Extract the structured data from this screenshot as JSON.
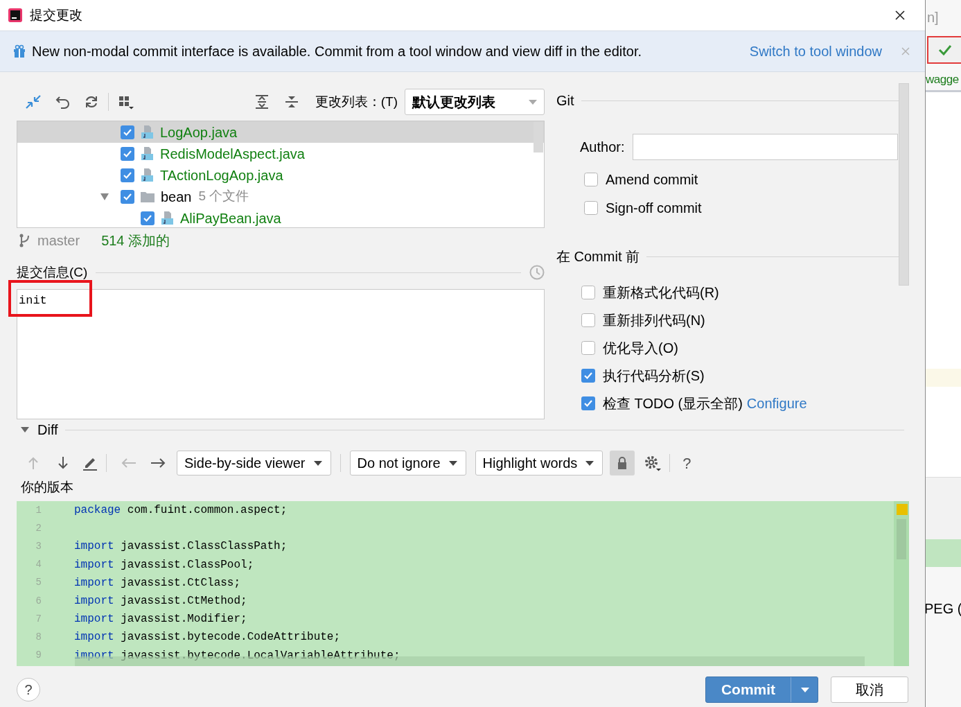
{
  "window": {
    "title": "提交更改"
  },
  "banner": {
    "text": "New non-modal commit interface is available. Commit from a tool window and view diff in the editor.",
    "link": "Switch to tool window"
  },
  "changes": {
    "changelist_label": "更改列表：(T)",
    "changelist": "默认更改列表",
    "tree": [
      {
        "kind": "file",
        "label": "LogAop.java",
        "checked": true,
        "selected": true
      },
      {
        "kind": "file",
        "label": "RedisModelAspect.java",
        "checked": true,
        "selected": false
      },
      {
        "kind": "file",
        "label": "TActionLogAop.java",
        "checked": true,
        "selected": false
      },
      {
        "kind": "folder",
        "label": "bean",
        "count": "5 个文件",
        "checked": true,
        "expanded": true,
        "selected": false,
        "children": [
          {
            "kind": "file",
            "label": "AliPayBean.java",
            "checked": true,
            "selected": false
          }
        ]
      }
    ],
    "branch": "master",
    "summary": "514 添加的"
  },
  "commit_message": {
    "label": "提交信息(C)",
    "value": "init"
  },
  "git": {
    "heading": "Git",
    "author_label": "Author:",
    "options": [
      {
        "label": "Amend commit",
        "checked": false
      },
      {
        "label": "Sign-off commit",
        "checked": false
      }
    ]
  },
  "before_commit": {
    "heading": "在 Commit 前",
    "options": [
      {
        "label": "重新格式化代码(R)",
        "checked": false
      },
      {
        "label": "重新排列代码(N)",
        "checked": false
      },
      {
        "label": "优化导入(O)",
        "checked": false
      },
      {
        "label": "执行代码分析(S)",
        "checked": true
      },
      {
        "label": "检查 TODO (显示全部)",
        "checked": true,
        "link": "Configure"
      }
    ]
  },
  "diff": {
    "heading": "Diff",
    "expanded": true,
    "viewer": "Side-by-side viewer",
    "ignore": "Do not ignore",
    "highlight": "Highlight words",
    "help": "?",
    "side_label": "你的版本",
    "lines": [
      {
        "number": "1",
        "keyword": "package",
        "text": "com.fuint.common.aspect;"
      },
      {
        "number": "2"
      },
      {
        "number": "3",
        "keyword": "import",
        "text": "javassist.ClassClassPath;"
      },
      {
        "number": "4",
        "keyword": "import",
        "text": "javassist.ClassPool;"
      },
      {
        "number": "5",
        "keyword": "import",
        "text": "javassist.CtClass;"
      },
      {
        "number": "6",
        "keyword": "import",
        "text": "javassist.CtMethod;"
      },
      {
        "number": "7",
        "keyword": "import",
        "text": "javassist.Modifier;"
      },
      {
        "number": "8",
        "keyword": "import",
        "text": "javassist.bytecode.CodeAttribute;"
      },
      {
        "number": "9",
        "keyword": "import",
        "text": "javassist.bytecode.LocalVariableAttribute;"
      }
    ]
  },
  "footer": {
    "help": "?",
    "commit": "Commit",
    "cancel": "取消"
  },
  "background_window": {
    "top_text": "n]",
    "name_text": "wagge",
    "lower_text": "PEG ("
  }
}
